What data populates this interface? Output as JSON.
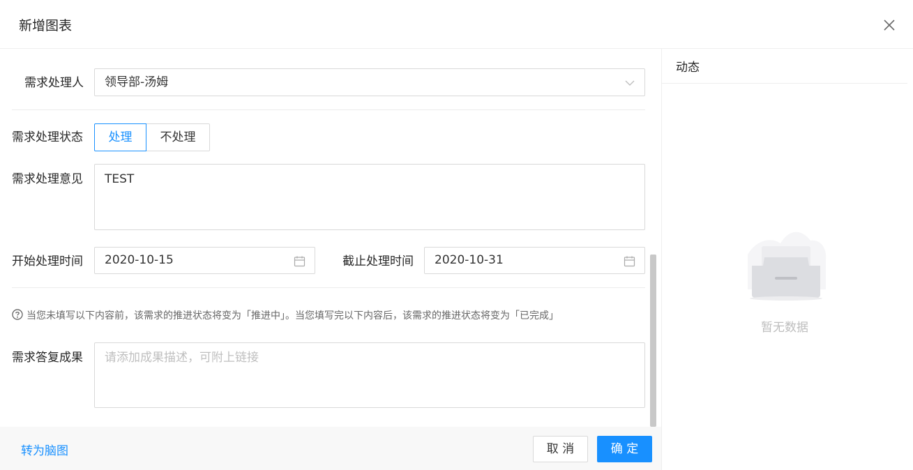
{
  "dialog": {
    "title": "新增图表"
  },
  "form": {
    "handler": {
      "label": "需求处理人",
      "value": "领导部-汤姆"
    },
    "status": {
      "label": "需求处理状态",
      "options": [
        "处理",
        "不处理"
      ],
      "selected": "处理"
    },
    "opinion": {
      "label": "需求处理意见",
      "value": "TEST"
    },
    "start_time": {
      "label": "开始处理时间",
      "value": "2020-10-15"
    },
    "end_time": {
      "label": "截止处理时间",
      "value": "2020-10-31"
    },
    "hint": "当您未填写以下内容前，该需求的推进状态将变为「推进中」。当您填写完以下内容后，该需求的推进状态将变为「已完成」",
    "result": {
      "label": "需求答复成果",
      "placeholder": "请添加成果描述，可附上链接"
    }
  },
  "footer": {
    "mindmap_link": "转为脑图",
    "cancel_label": "取 消",
    "ok_label": "确 定"
  },
  "side": {
    "title": "动态",
    "empty_text": "暂无数据"
  },
  "colors": {
    "primary": "#1890ff",
    "border": "#d9d9d9",
    "text": "#333333",
    "placeholder": "#bfbfbf"
  },
  "icons": {
    "close": "close-icon",
    "dropdown": "chevron-down-icon",
    "calendar": "calendar-icon",
    "help": "question-circle-icon",
    "empty": "empty-box-icon"
  }
}
